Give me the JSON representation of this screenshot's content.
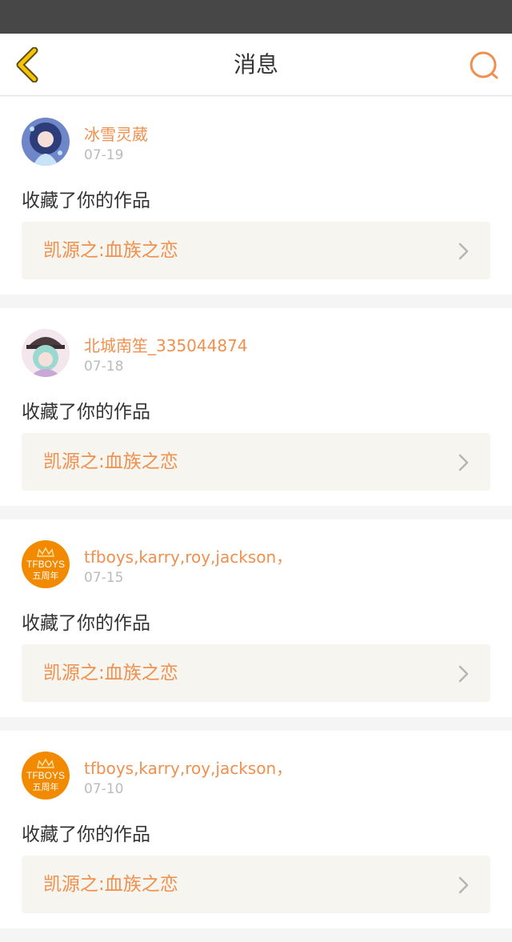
{
  "header": {
    "title": "消息",
    "back_icon": "back-arrow-icon",
    "search_icon": "search-icon"
  },
  "colors": {
    "accent": "#f0904e",
    "back_icon": "#f5c400",
    "status_bar": "#474747",
    "background": "#f5f5f5",
    "work_box": "#f6f5ef"
  },
  "messages": [
    {
      "username": "冰雪灵葳",
      "date": "07-19",
      "action": "收藏了你的作品",
      "work_title": "凯源之:血族之恋",
      "avatar": "anime-girl-avatar"
    },
    {
      "username": "北城南笙_335044874",
      "date": "07-18",
      "action": "收藏了你的作品",
      "work_title": "凯源之:血族之恋",
      "avatar": "anime-girl-hat-avatar"
    },
    {
      "username": "tfboys,karry,roy,jackson，",
      "date": "07-15",
      "action": "收藏了你的作品",
      "work_title": "凯源之:血族之恋",
      "avatar": "tfboys-logo-avatar",
      "avatar_text": {
        "line1": "TFBOYS",
        "line2": "五周年"
      }
    },
    {
      "username": "tfboys,karry,roy,jackson，",
      "date": "07-10",
      "action": "收藏了你的作品",
      "work_title": "凯源之:血族之恋",
      "avatar": "tfboys-logo-avatar",
      "avatar_text": {
        "line1": "TFBOYS",
        "line2": "五周年"
      }
    }
  ]
}
